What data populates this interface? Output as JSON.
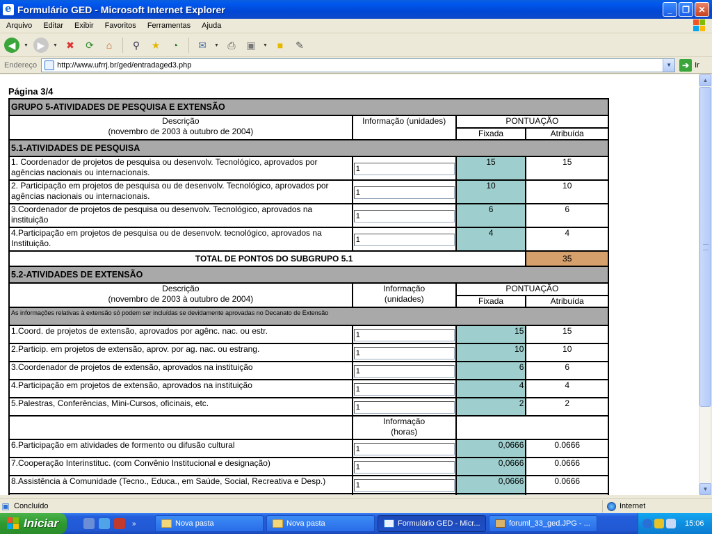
{
  "window": {
    "title": "Formulário GED - Microsoft Internet Explorer",
    "buttons": {
      "minimize": "_",
      "maximize": "❐",
      "close": "✕"
    }
  },
  "menu": [
    "Arquivo",
    "Editar",
    "Exibir",
    "Favoritos",
    "Ferramentas",
    "Ajuda"
  ],
  "address": {
    "label": "Endereço",
    "url": "http://www.ufrrj.br/ged/entradaged3.php",
    "go_label": "Ir"
  },
  "page": {
    "heading": "Página 3/4",
    "group_title": "GRUPO 5-ATIVIDADES DE PESQUISA E EXTENSÃO",
    "header": {
      "desc_line1": "Descrição",
      "desc_line2": "(novembro de 2003 à outubro de 2004)",
      "info": "Informação (unidades)",
      "pontuacao": "PONTUAÇÃO",
      "fixada": "Fixada",
      "atribuida": "Atribuída"
    },
    "sub1": {
      "title": "5.1-ATIVIDADES DE PESQUISA",
      "rows": [
        {
          "desc": "1. Coordenador de projetos de pesquisa ou desenvolv. Tecnológico, aprovados por agências nacionais ou internacionais.",
          "info": "1",
          "fixada": "15",
          "atribuida": "15"
        },
        {
          "desc": "2. Participação em projetos de pesquisa ou de desenvolv. Tecnológico, aprovados por agências nacionais ou internacionais.",
          "info": "1",
          "fixada": "10",
          "atribuida": "10"
        },
        {
          "desc": "3.Coordenador de projetos de pesquisa ou desenvolv. Tecnológico, aprovados na instituição",
          "info": "1",
          "fixada": "6",
          "atribuida": "6"
        },
        {
          "desc": "4.Participação em projetos de pesquisa ou de desenvolv. tecnológico, aprovados na Instituição.",
          "info": "1",
          "fixada": "4",
          "atribuida": "4"
        }
      ],
      "total_label": "TOTAL DE PONTOS DO SUBGRUPO 5.1",
      "total_value": "35"
    },
    "sub2": {
      "title": "5.2-ATIVIDADES DE EXTENSÃO",
      "info_line1": "Informação",
      "info_line2": "(unidades)",
      "note": "As informações relativas à extensão só podem ser incluídas se devidamente aprovadas no Decanato de Extensão",
      "rows": [
        {
          "desc": "1.Coord. de projetos de extensão, aprovados por agênc. nac. ou estr.",
          "info": "1",
          "fixada": "15",
          "atribuida": "15"
        },
        {
          "desc": "2.Particip. em projetos de extensão, aprov. por ag. nac. ou estrang.",
          "info": "1",
          "fixada": "10",
          "atribuida": "10"
        },
        {
          "desc": "3.Coordenador de projetos de extensão, aprovados na instituição",
          "info": "1",
          "fixada": "6",
          "atribuida": "6"
        },
        {
          "desc": "4.Participação em projetos de extensão, aprovados na instituição",
          "info": "1",
          "fixada": "4",
          "atribuida": "4"
        },
        {
          "desc": "5.Palestras, Conferências, Mini-Cursos, oficinais, etc.",
          "info": "1",
          "fixada": "2",
          "atribuida": "2"
        }
      ],
      "hours_line1": "Informação",
      "hours_line2": "(horas)",
      "hour_rows": [
        {
          "desc": "6.Participação em atividades de formento ou difusão cultural",
          "info": "1",
          "fixada": "0,0666",
          "atribuida": "0.0666"
        },
        {
          "desc": "7.Cooperação Interinstituc. (com Convênio Institucional e designação)",
          "info": "1",
          "fixada": "0,0666",
          "atribuida": "0.0666"
        },
        {
          "desc": "8.Assistência à Comunidade (Tecno., Educa., em Saúde, Social, Recreativa e Desp.)",
          "info": "1",
          "fixada": "0,0666",
          "atribuida": "0.0666"
        }
      ]
    }
  },
  "status": {
    "text": "Concluído",
    "zone": "Internet"
  },
  "taskbar": {
    "start_label": "Iniciar",
    "buttons": [
      "Nova pasta",
      "Nova pasta",
      "Formulário GED - Micr...",
      "foruml_33_ged.JPG - ..."
    ],
    "clock": "15:06"
  }
}
